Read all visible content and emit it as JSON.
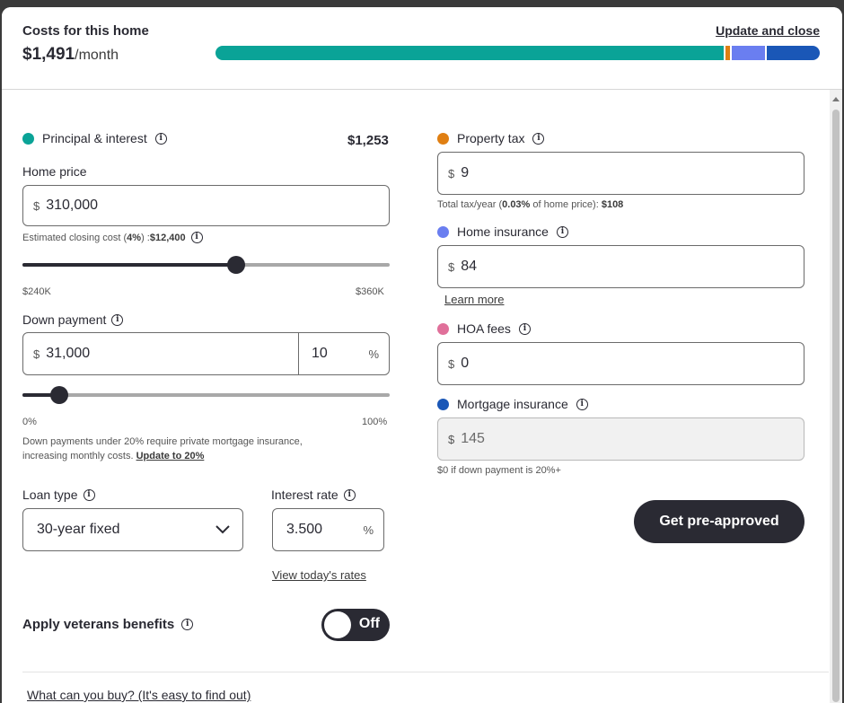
{
  "header": {
    "title": "Costs for this home",
    "monthly_amount": "$1,491",
    "per_month": "/month",
    "update_close": "Update and close"
  },
  "breakdown_bar": {
    "segments": [
      {
        "name": "Principal & interest",
        "color": "#0aa397"
      },
      {
        "name": "Property tax",
        "color": "#e07f12"
      },
      {
        "name": "Home insurance",
        "color": "#6a7ef0"
      },
      {
        "name": "Mortgage insurance",
        "color": "#1a57b7"
      }
    ]
  },
  "principal": {
    "label": "Principal & interest",
    "amount": "$1,253",
    "color": "#0aa397"
  },
  "home_price": {
    "label": "Home price",
    "currency": "$",
    "value": "310,000",
    "closing_prefix": "Estimated closing cost (",
    "closing_pct": "4%",
    "closing_mid": ") : ",
    "closing_value": "$12,400",
    "slider_min_label": "$240K",
    "slider_max_label": "$360K",
    "slider_fraction": 0.583
  },
  "down_payment": {
    "label": "Down payment",
    "currency": "$",
    "value": "31,000",
    "percent": "10",
    "percent_sign": "%",
    "slider_min_label": "0%",
    "slider_max_label": "100%",
    "slider_fraction": 0.1,
    "note_line1": "Down payments under 20% require private mortgage insurance,",
    "note_line2": "increasing monthly costs.",
    "note_link": "Update to 20%"
  },
  "loan_type": {
    "label": "Loan type",
    "selected": "30-year fixed"
  },
  "interest_rate": {
    "label": "Interest rate",
    "value": "3.500",
    "percent_sign": "%",
    "link": "View today's rates"
  },
  "veterans": {
    "label": "Apply veterans benefits",
    "toggle_state": "Off"
  },
  "footer_link": "What can you buy? (It's easy to find out)",
  "property_tax": {
    "label": "Property tax",
    "color": "#e07f12",
    "currency": "$",
    "value": "9",
    "note_prefix": "Total tax/year (",
    "note_pct": "0.03%",
    "note_mid": " of home price): ",
    "note_value": "$108"
  },
  "home_insurance": {
    "label": "Home insurance",
    "color": "#6a7ef0",
    "currency": "$",
    "value": "84",
    "link": "Learn more"
  },
  "hoa": {
    "label": "HOA fees",
    "color": "#e0709a",
    "currency": "$",
    "value": "0"
  },
  "mortgage_insurance": {
    "label": "Mortgage insurance",
    "color": "#1a57b7",
    "currency": "$",
    "value": "145",
    "note": "$0 if down payment is 20%+"
  },
  "preapproved_button": "Get pre-approved"
}
